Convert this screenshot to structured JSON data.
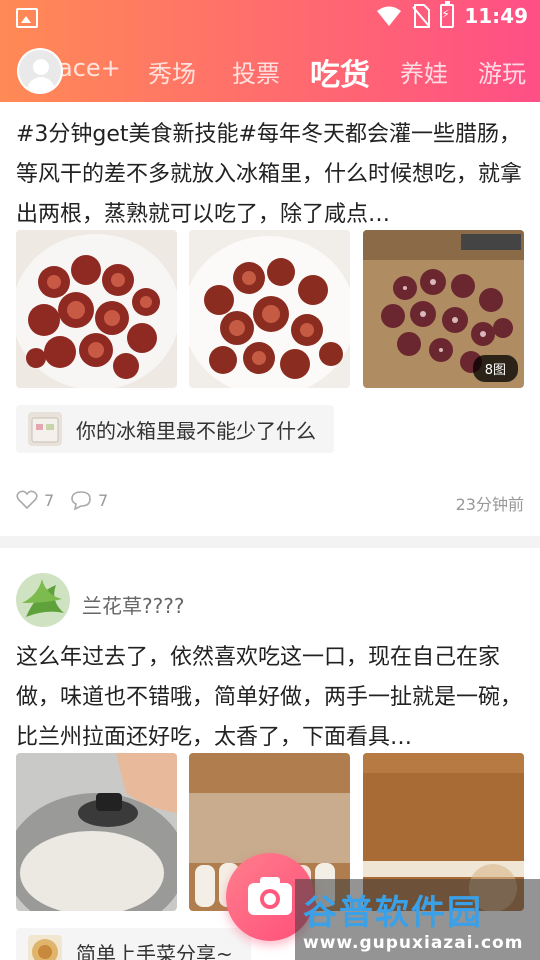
{
  "status_bar": {
    "time": "11:49"
  },
  "nav": {
    "tabs": [
      {
        "label": "ace+"
      },
      {
        "label": "秀场"
      },
      {
        "label": "投票"
      },
      {
        "label": "吃货",
        "active": true
      },
      {
        "label": "养娃"
      },
      {
        "label": "游玩"
      }
    ]
  },
  "posts": [
    {
      "text": "#3分钟get美食新技能#每年冬天都会灌一些腊肠，等风干的差不多就放入冰箱里，什么时候想吃，就拿出两根，蒸熟就可以吃了，除了咸点…",
      "image_count_badge": "8图",
      "topic": "你的冰箱里最不能少了什么",
      "likes": "7",
      "comments": "7",
      "time": "23分钟前"
    },
    {
      "author": "兰花草????",
      "text": "这么年过去了，依然喜欢吃这一口，现在自己在家做，味道也不错哦，简单好做，两手一扯就是一碗，比兰州拉面还好吃，太香了，下面看具…",
      "topic": "简单上手菜分享~"
    }
  ],
  "watermark": {
    "title": "谷普软件园",
    "url": "www.gupuxiazai.com"
  },
  "colors": {
    "header_start": "#ff8a55",
    "header_end": "#ff4f86",
    "fab": "#ff5a7e"
  }
}
